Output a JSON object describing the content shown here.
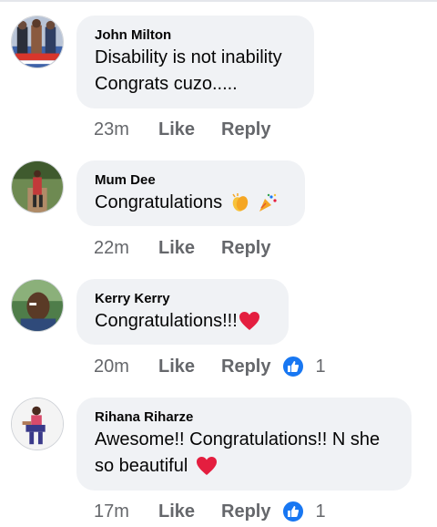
{
  "comments": [
    {
      "author": "John Milton",
      "lines": [
        "Disability is not inability",
        "Congrats cuzo....."
      ],
      "time": "23m",
      "like_label": "Like",
      "reply_label": "Reply",
      "reactions": null
    },
    {
      "author": "Mum Dee",
      "lines": [
        "Congratulations"
      ],
      "emojis": [
        "clapping-hands-icon",
        "party-popper-icon"
      ],
      "time": "22m",
      "like_label": "Like",
      "reply_label": "Reply",
      "reactions": null
    },
    {
      "author": "Kerry Kerry",
      "lines": [
        "Congratulations!!!"
      ],
      "emojis": [
        "red-heart-icon"
      ],
      "time": "20m",
      "like_label": "Like",
      "reply_label": "Reply",
      "reactions": {
        "icon": "like-reaction-icon",
        "count": "1"
      }
    },
    {
      "author": "Rihana Riharze",
      "lines": [
        "Awesome!! Congratulations!! N she",
        "so beautiful"
      ],
      "emojis": [
        "red-heart-icon"
      ],
      "time": "17m",
      "like_label": "Like",
      "reply_label": "Reply",
      "reactions": {
        "icon": "like-reaction-icon",
        "count": "1"
      }
    }
  ],
  "colors": {
    "bubble": "#f0f2f5",
    "meta_text": "#65676b",
    "like_badge": "#1877f2",
    "heart": "#e41e3f"
  }
}
